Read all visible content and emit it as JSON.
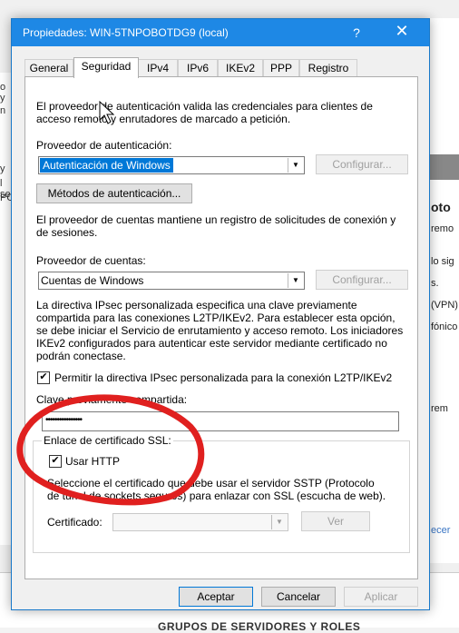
{
  "background": {
    "left_fragments": [
      "o y",
      "n",
      "y",
      "l se",
      "PO"
    ],
    "right_fragments": [
      "oto",
      "remo",
      "lo sig",
      "s.",
      "(VPN)",
      "fónico",
      "rem",
      "ecer"
    ],
    "bottom_heading": "GRUPOS DE SERVIDORES Y ROLES"
  },
  "dialog": {
    "title": "Propiedades: WIN-5TNPOBOTDG9 (local)",
    "help_label": "?",
    "close_label": "✕"
  },
  "tabs": [
    {
      "label": "General"
    },
    {
      "label": "Seguridad"
    },
    {
      "label": "IPv4"
    },
    {
      "label": "IPv6"
    },
    {
      "label": "IKEv2"
    },
    {
      "label": "PPP"
    },
    {
      "label": "Registro"
    }
  ],
  "security": {
    "auth_description_line1": "El proveedor de autenticación valida las credenciales para clientes de",
    "auth_description_line2": "acceso remoto y enrutadores de marcado a petición.",
    "auth_provider_label": "Proveedor de autenticación:",
    "auth_provider_value": "Autenticación de Windows",
    "configure_button": "Configurar...",
    "auth_methods_button": "Métodos de autenticación...",
    "accounting_description_line1": "El proveedor de cuentas mantiene un registro de solicitudes de conexión y",
    "accounting_description_line2": "de sesiones.",
    "accounting_provider_label": "Proveedor de cuentas:",
    "accounting_provider_value": "Cuentas de Windows",
    "configure_button2": "Configurar...",
    "ipsec_line1": "La directiva IPsec personalizada especifica una clave previamente",
    "ipsec_line2": "compartida para las conexiones L2TP/IKEv2. Para establecer esta opción,",
    "ipsec_line3": "se debe iniciar el Servicio de enrutamiento y acceso remoto. Los iniciadores",
    "ipsec_line4": "IKEv2 configurados para autenticar este servidor mediante certificado no",
    "ipsec_line5": "podrán conectase.",
    "ipsec_checkbox_label": "Permitir la directiva IPsec personalizada para la conexión L2TP/IKEv2",
    "ipsec_checked": true,
    "psk_label": "Clave previamente compartida:",
    "psk_value": "••••••••••••••••",
    "ssl_group_label": "Enlace de certificado SSL:",
    "use_http_label": "Usar HTTP",
    "use_http_checked": true,
    "ssl_desc_line1": "Seleccione el certificado que debe usar el servidor SSTP (Protocolo",
    "ssl_desc_line2": "de túnel de sockets seguros) para enlazar con SSL (escucha de web).",
    "certificate_label": "Certificado:",
    "certificate_value": "",
    "view_button": "Ver"
  },
  "footer": {
    "accept": "Aceptar",
    "cancel": "Cancelar",
    "apply": "Aplicar"
  },
  "colors": {
    "titlebar": "#1e88e5",
    "selection": "#0078d7",
    "annotation": "#e0201f"
  }
}
